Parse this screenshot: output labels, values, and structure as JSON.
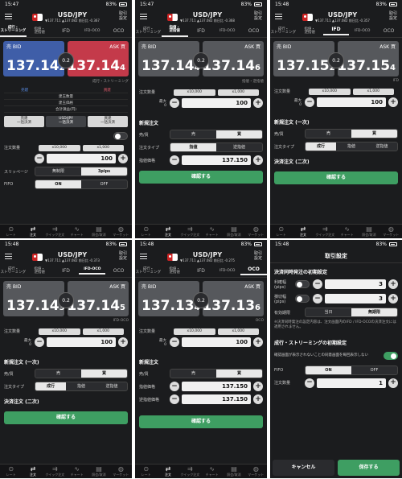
{
  "status": {
    "t1": "15:47",
    "t2": "15:47",
    "t3": "15:48",
    "t4": "15:48",
    "t5": "15:48",
    "t6": "15:48",
    "battery": "83%"
  },
  "pair": {
    "name": "USD/JPY",
    "sub1": "▼137.711 ▲137.082 前日比 -0.367",
    "sub2": "▼137.711 ▲137.082 前日比 -0.368",
    "sub3": "▼137.711 ▲137.082 前日比 -0.357",
    "sub4": "▼137.711 ▲137.082 前日比 -0.373",
    "sub5": "▼137.711 ▲137.082 前日比 -0.275"
  },
  "header": {
    "trade_setting": "取引\n設定"
  },
  "tabs": {
    "streaming": "成行・\nストリーミング",
    "limit": "指値・\n逆指値",
    "ifd": "IFD",
    "ifdoco": "IFD-OCO",
    "oco": "OCO"
  },
  "labels": {
    "bid": "売 BID",
    "ask": "ASK 買",
    "spread": "0.2",
    "qty": "注文数量",
    "max": "最大\n0",
    "slippage": "スリッページ",
    "fifo": "FIFO",
    "new_order": "新規注文",
    "new_order_1": "新規注文 (一次)",
    "side": "売/買",
    "sell": "売",
    "buy": "買",
    "order_type": "注文タイプ",
    "limit": "指値",
    "stop": "逆指値",
    "market": "成行",
    "price": "指値価格",
    "stop_price": "逆指値価格",
    "settle": "決済注文 (二次)",
    "confirm": "確認する",
    "unlimited": "無制限",
    "pips": "3pips",
    "on": "ON",
    "off": "OFF",
    "step": "1"
  },
  "p1": {
    "bid": "137.14",
    "bid_s": "2",
    "ask": "137.14",
    "ask_s": "4",
    "mode": "成行・ストリーミング",
    "qty": "100",
    "chip1": "x10,000",
    "chip2": "x1,000"
  },
  "p2": {
    "bid": "137.14",
    "bid_s": "4",
    "ask": "137.14",
    "ask_s": "6",
    "mode": "指値・逆指値",
    "qty": "100",
    "chip1": "x10,000",
    "chip2": "x1,000",
    "price": "137.150"
  },
  "p3": {
    "bid": "137.15",
    "bid_s": "2",
    "ask": "137.15",
    "ask_s": "4",
    "mode": "IFD",
    "qty": "100",
    "chip1": "x10,000",
    "chip2": "x1,000"
  },
  "p4": {
    "bid": "137.14",
    "bid_s": "3",
    "ask": "137.14",
    "ask_s": "5",
    "mode": "IFD-OCO",
    "qty": "100",
    "chip1": "x10,000",
    "chip2": "x1,000"
  },
  "p5": {
    "bid": "137.13",
    "bid_s": "4",
    "ask": "137.13",
    "ask_s": "6",
    "mode": "OCO",
    "qty": "100",
    "chip1": "x10,000",
    "chip2": "x1,000",
    "price": "137.150",
    "stop_price": "137.150"
  },
  "table1": {
    "h1": "売建",
    "h2": "買建",
    "r1": "建玉数量",
    "r2": "建玉価格",
    "r3": "合計損益(円)"
  },
  "buttons1": {
    "b1": "売建\n一括決済",
    "b2": "USD/JPY\n一括決済",
    "b3": "買建\n一括決済"
  },
  "nav": [
    {
      "icon": "⊙",
      "label": "レート"
    },
    {
      "icon": "⇄",
      "label": "注文"
    },
    {
      "icon": "⇉",
      "label": "クイック注文"
    },
    {
      "icon": "∿",
      "label": "チャート"
    },
    {
      "icon": "▤",
      "label": "照会/取消"
    },
    {
      "icon": "◍",
      "label": "マーケット"
    }
  ],
  "dialog": {
    "title": "取引設定",
    "sec1": "決済同時発注の初期設定",
    "profit": "利確幅\n(pips)",
    "loss": "損切幅\n(pips)",
    "profit_v": "3",
    "loss_v": "3",
    "expiry": "有効期限",
    "today": "当日",
    "unlimited": "無期限",
    "note": "※決済同時発注の設定内容は、注文画面内のIFD / IFD-OCOの決済注文には適用されません。",
    "sec2": "成行・ストリーミングの初期設定",
    "confirm_skip": "確認画面が表示されないことの同意画面を毎回表示しない",
    "fifo": "FIFO",
    "qty": "注文数量",
    "qty_v": "1",
    "cancel": "キャンセル",
    "save": "保存する"
  }
}
